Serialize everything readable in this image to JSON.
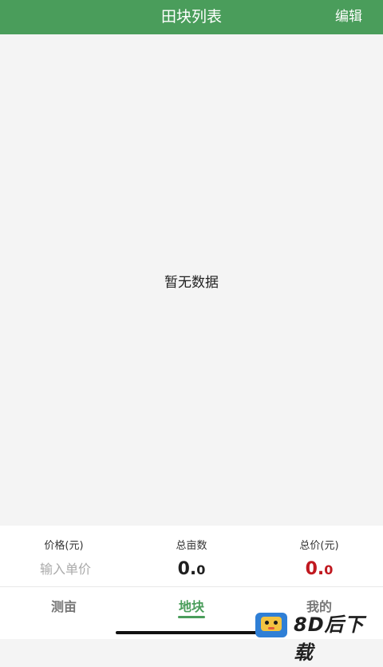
{
  "header": {
    "title": "田块列表",
    "edit_label": "编辑"
  },
  "content": {
    "empty_text": "暂无数据"
  },
  "summary": {
    "price_label": "价格(元)",
    "price_placeholder": "输入单价",
    "area_label": "总亩数",
    "area_value_int": "0.",
    "area_value_dec": "0",
    "total_label": "总价(元)",
    "total_value_int": "0.",
    "total_value_dec": "0"
  },
  "tabs": [
    {
      "label": "测亩"
    },
    {
      "label": "地块"
    },
    {
      "label": "我的"
    }
  ],
  "watermark": {
    "text": "8D后下载"
  },
  "colors": {
    "brand_green": "#4a9d5b",
    "total_red": "#c0181f",
    "background": "#f4f4f4"
  }
}
